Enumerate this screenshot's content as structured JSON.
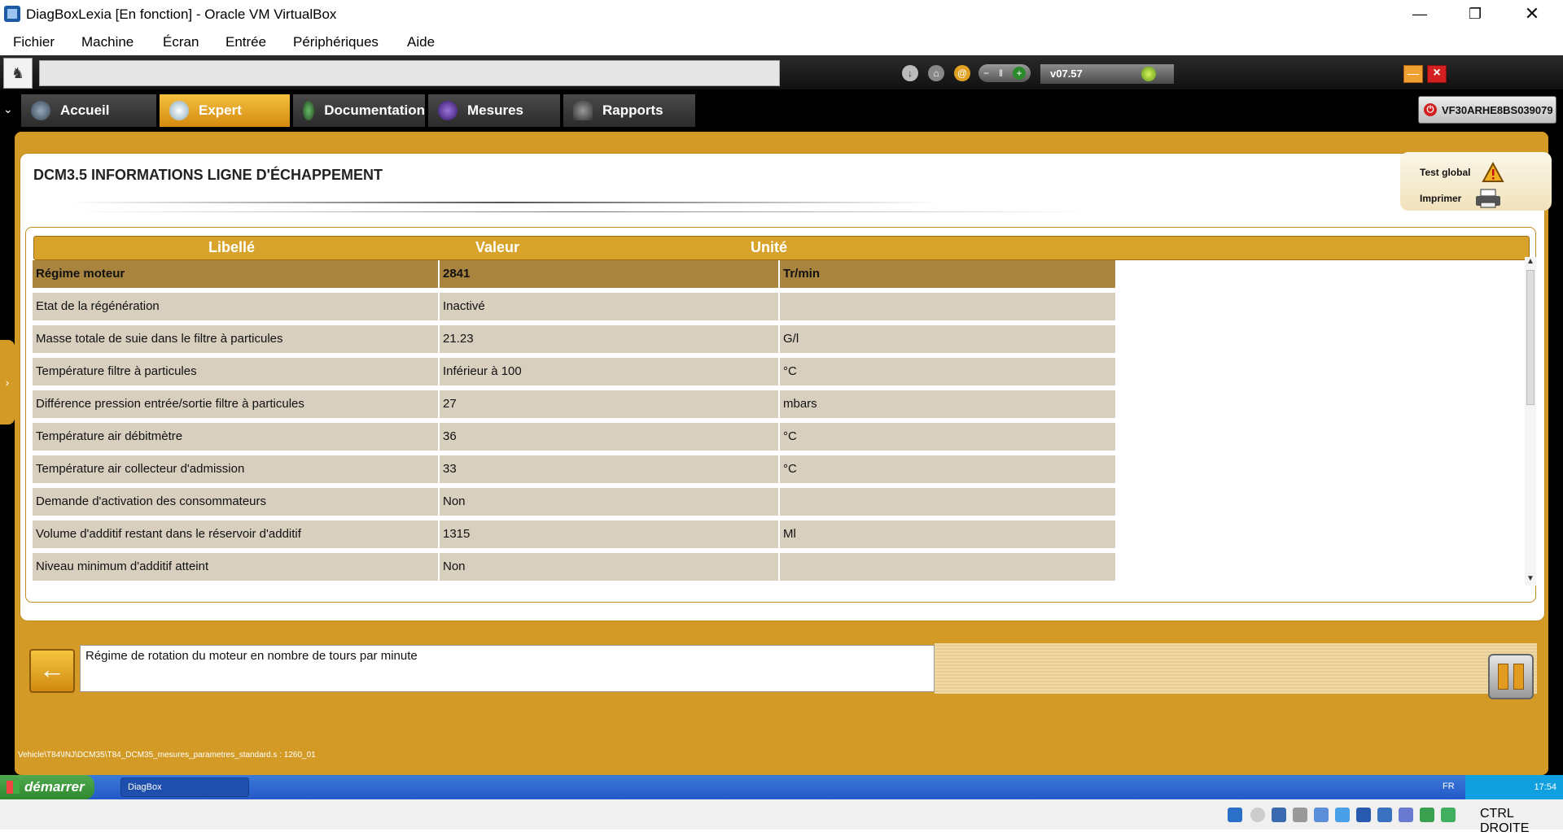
{
  "window": {
    "title": "DiagBoxLexia [En fonction] - Oracle VM VirtualBox"
  },
  "menubar": [
    "Fichier",
    "Machine",
    "Écran",
    "Entrée",
    "Périphériques",
    "Aide"
  ],
  "toolbar": {
    "version": "v07.57"
  },
  "tabs": [
    "Accueil",
    "Expert",
    "Documentation",
    "Mesures",
    "Rapports"
  ],
  "vin": "VF30ARHE8BS039079",
  "side_actions": {
    "test_global": "Test global",
    "print": "Imprimer"
  },
  "page": {
    "title": "DCM3.5  INFORMATIONS LIGNE D'ÉCHAPPEMENT"
  },
  "table": {
    "headers": [
      "Libellé",
      "Valeur",
      "Unité"
    ],
    "rows": [
      {
        "label": "Régime moteur",
        "value": "2841",
        "unit": "Tr/min"
      },
      {
        "label": "Etat de la régénération",
        "value": "Inactivé",
        "unit": ""
      },
      {
        "label": "Masse totale de suie dans le filtre à particules",
        "value": "21.23",
        "unit": "G/l"
      },
      {
        "label": "Température filtre à particules",
        "value": "Inférieur à 100",
        "unit": "°C"
      },
      {
        "label": "Différence pression entrée/sortie filtre à particules",
        "value": "27",
        "unit": "mbars"
      },
      {
        "label": "Température air débitmètre",
        "value": "36",
        "unit": "°C"
      },
      {
        "label": "Température air collecteur d'admission",
        "value": "33",
        "unit": "°C"
      },
      {
        "label": "Demande d'activation des consommateurs",
        "value": "Non",
        "unit": ""
      },
      {
        "label": "Volume d'additif restant dans le réservoir d'additif",
        "value": "1315",
        "unit": "Ml"
      },
      {
        "label": "Niveau minimum d'additif atteint",
        "value": "Non",
        "unit": ""
      }
    ]
  },
  "description": "Régime de rotation du moteur en nombre de tours par minute",
  "path": "Vehicle\\T84\\INJ\\DCM35\\T84_DCM35_mesures_parametres_standard.s : 1260_01",
  "xp_taskbar": {
    "start": "démarrer",
    "task": "DiagBox",
    "lang": "FR",
    "clock": "17:54"
  },
  "host_status": {
    "host_key": "CTRL DROITE"
  },
  "colors": {
    "accent": "#d39b26",
    "selected_row": "#a8843f",
    "row": "#d8cfbf"
  }
}
